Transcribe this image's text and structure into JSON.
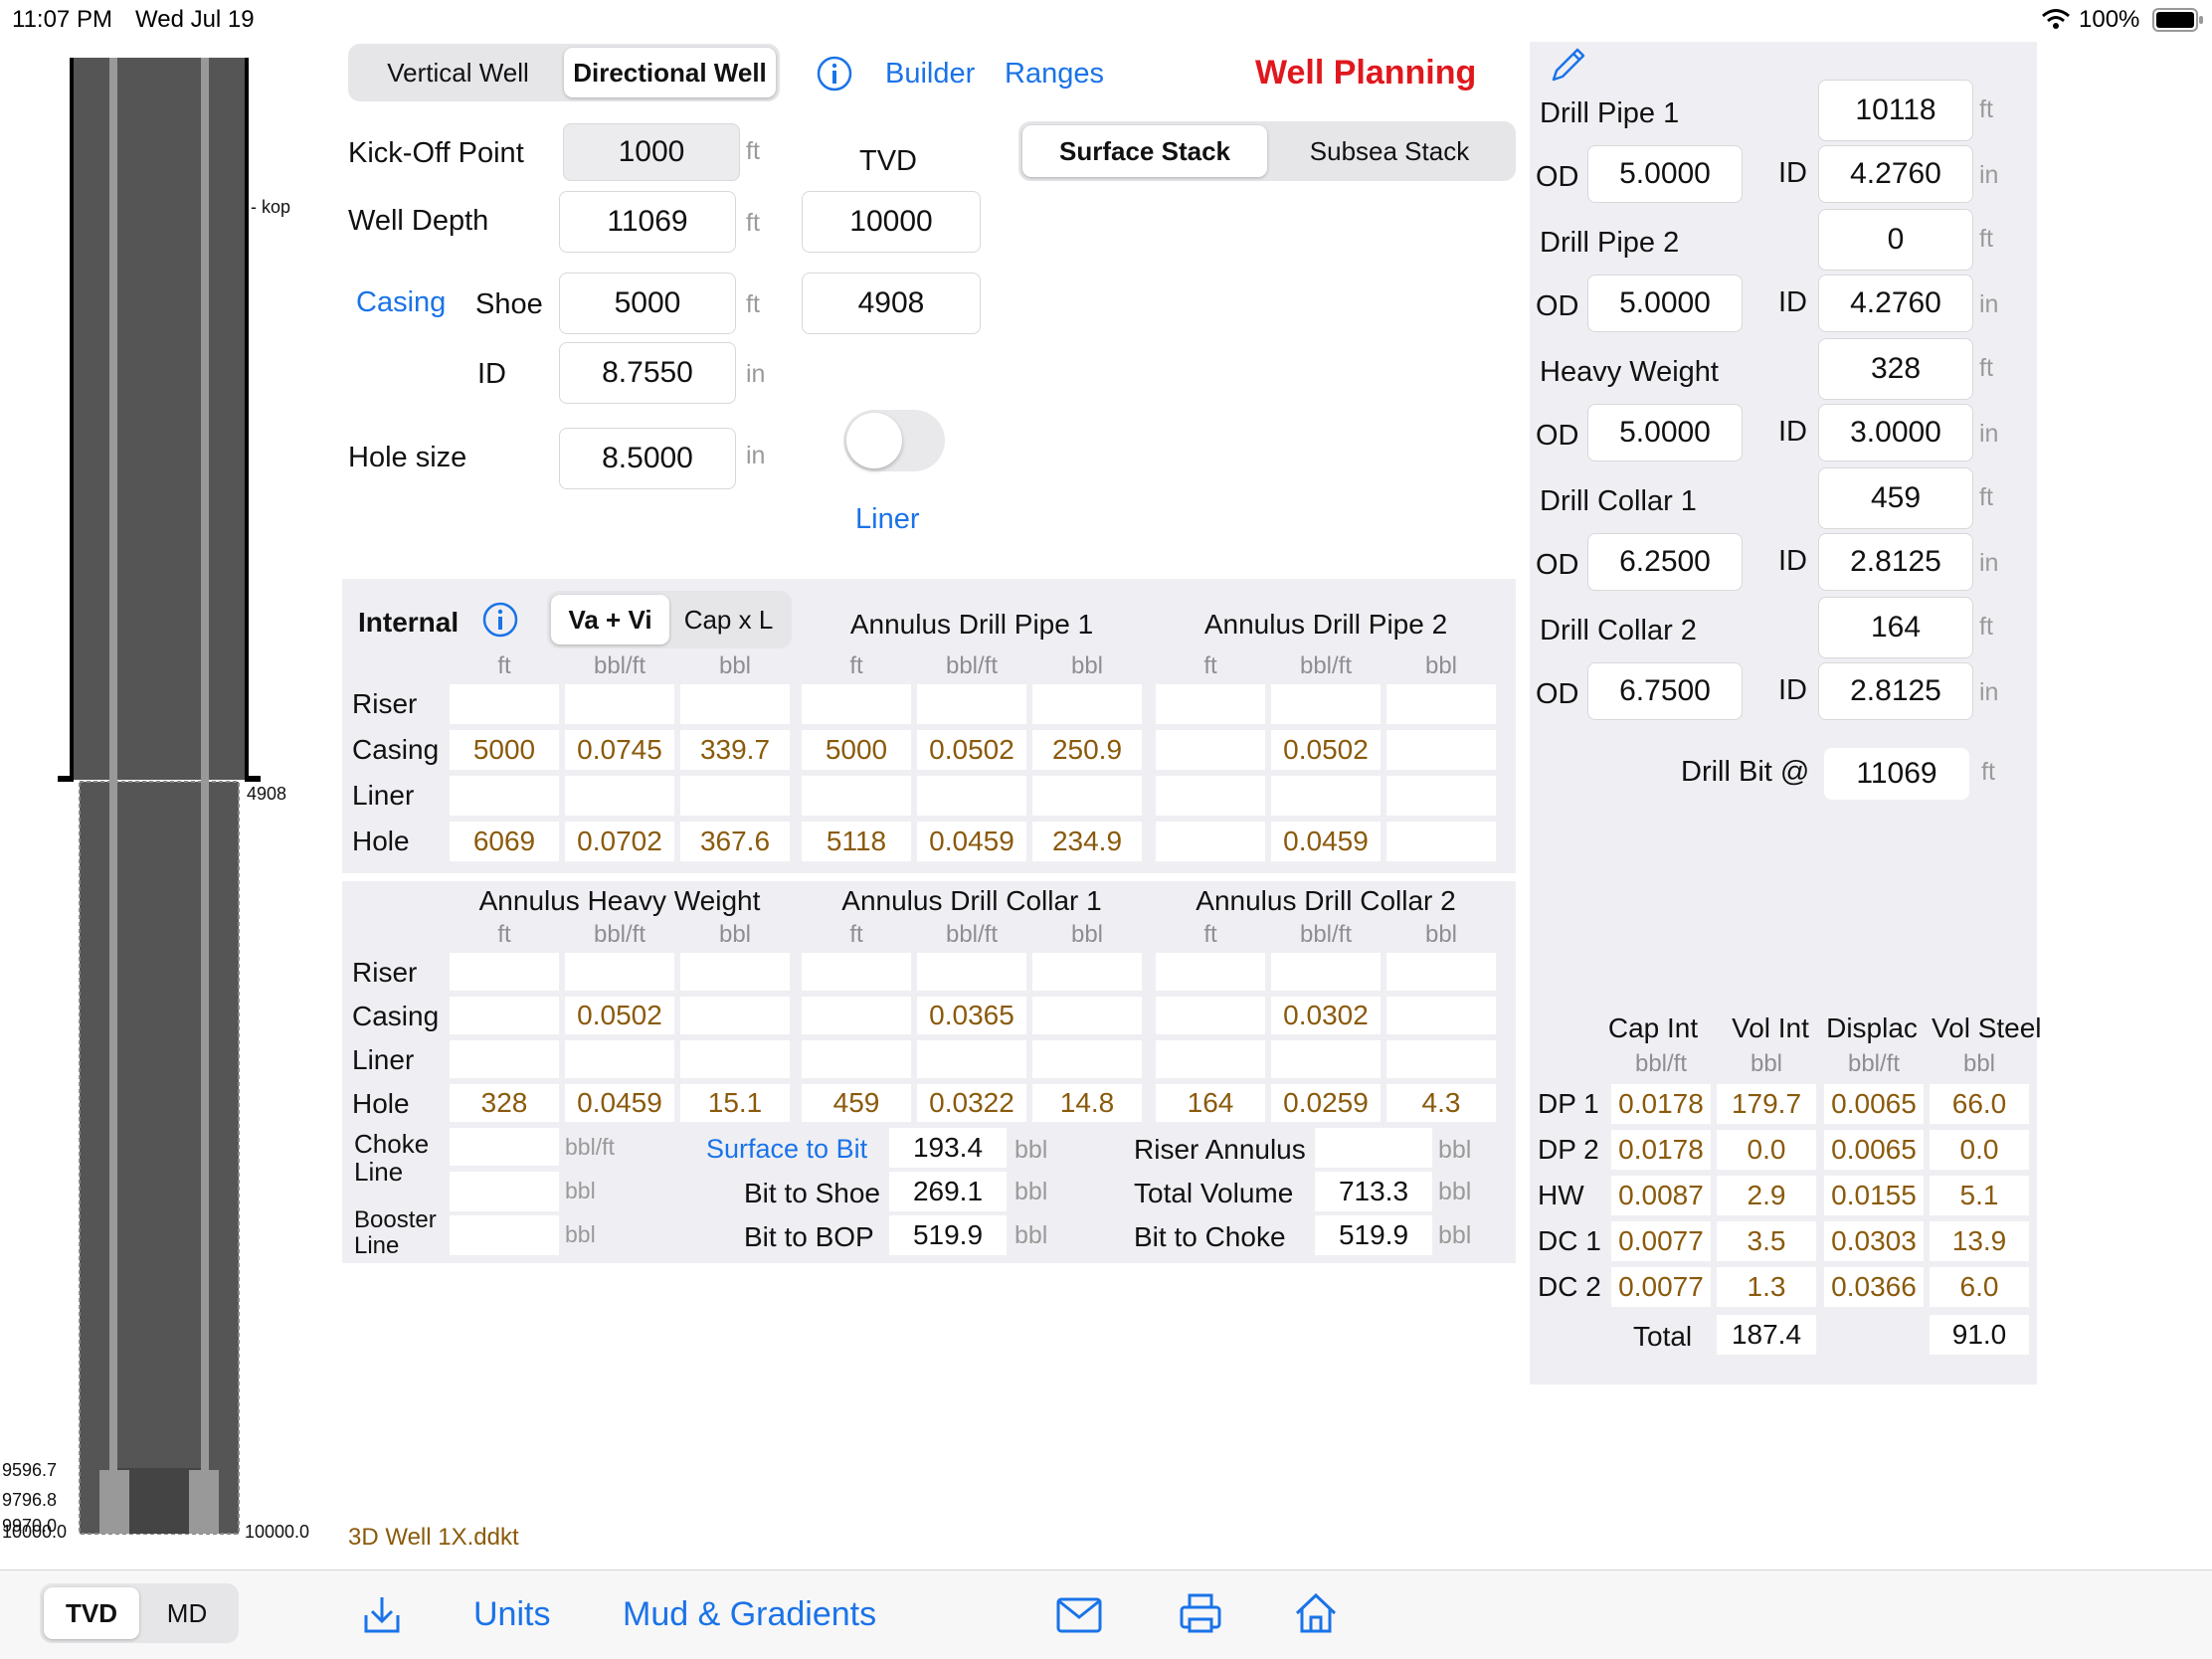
{
  "status": {
    "time": "11:07 PM",
    "date": "Wed Jul 19",
    "battery": "100%"
  },
  "well_tabs": {
    "options": [
      "Vertical Well",
      "Directional Well"
    ],
    "selected": "Directional Well"
  },
  "nav": {
    "info_icon": "info-icon",
    "builder": "Builder",
    "ranges": "Ranges"
  },
  "title": "Well Planning",
  "stack_tabs": {
    "options": [
      "Surface Stack",
      "Subsea Stack"
    ],
    "selected": "Surface Stack"
  },
  "well": {
    "kop_label": "Kick-Off Point",
    "kop_value": "1000",
    "kop_unit": "ft",
    "tvd_label": "TVD",
    "depth_label": "Well Depth",
    "depth_value": "11069",
    "depth_unit": "ft",
    "depth_tvd": "10000",
    "casing_link": "Casing",
    "shoe_label": "Shoe",
    "shoe_value": "5000",
    "shoe_unit": "ft",
    "shoe_tvd": "4908",
    "id_label": "ID",
    "id_value": "8.7550",
    "id_unit": "in",
    "hole_label": "Hole size",
    "hole_value": "8.5000",
    "hole_unit": "in",
    "liner_label": "Liner"
  },
  "drill_string": {
    "dp1": {
      "label": "Drill Pipe 1",
      "length": "10118",
      "od": "5.0000",
      "id": "4.2760"
    },
    "dp2": {
      "label": "Drill Pipe 2",
      "length": "0",
      "od": "5.0000",
      "id": "4.2760"
    },
    "hw": {
      "label": "Heavy Weight",
      "length": "328",
      "od": "5.0000",
      "id": "3.0000"
    },
    "dc1": {
      "label": "Drill Collar 1",
      "length": "459",
      "od": "6.2500",
      "id": "2.8125"
    },
    "dc2": {
      "label": "Drill Collar 2",
      "length": "164",
      "od": "6.7500",
      "id": "2.8125"
    },
    "od_label": "OD",
    "id_label": "ID",
    "ft": "ft",
    "in": "in",
    "bit_label": "Drill Bit @",
    "bit_value": "11069",
    "bit_unit": "ft"
  },
  "internal": {
    "title": "Internal",
    "toggle": {
      "options": [
        "Va + Vi",
        "Cap x L"
      ],
      "selected": "Va + Vi"
    },
    "sub_units": [
      "ft",
      "bbl/ft",
      "bbl"
    ],
    "rows": [
      "Riser",
      "Casing",
      "Liner",
      "Hole"
    ],
    "groups": [
      {
        "title": "",
        "cells": [
          [
            "",
            "",
            ""
          ],
          [
            "5000",
            "0.0745",
            "339.7"
          ],
          [
            "",
            "",
            ""
          ],
          [
            "6069",
            "0.0702",
            "367.6"
          ]
        ]
      },
      {
        "title": "Annulus Drill Pipe 1",
        "cells": [
          [
            "",
            "",
            ""
          ],
          [
            "5000",
            "0.0502",
            "250.9"
          ],
          [
            "",
            "",
            ""
          ],
          [
            "5118",
            "0.0459",
            "234.9"
          ]
        ]
      },
      {
        "title": "Annulus Drill Pipe 2",
        "cells": [
          [
            "",
            "",
            ""
          ],
          [
            "",
            "0.0502",
            ""
          ],
          [
            "",
            "",
            ""
          ],
          [
            "",
            "0.0459",
            ""
          ]
        ]
      }
    ]
  },
  "annulus2": {
    "sub_units": [
      "ft",
      "bbl/ft",
      "bbl"
    ],
    "rows": [
      "Riser",
      "Casing",
      "Liner",
      "Hole"
    ],
    "groups": [
      {
        "title": "Annulus Heavy Weight",
        "cells": [
          [
            "",
            "",
            ""
          ],
          [
            "",
            "0.0502",
            ""
          ],
          [
            "",
            "",
            ""
          ],
          [
            "328",
            "0.0459",
            "15.1"
          ]
        ]
      },
      {
        "title": "Annulus Drill Collar 1",
        "cells": [
          [
            "",
            "",
            ""
          ],
          [
            "",
            "0.0365",
            ""
          ],
          [
            "",
            "",
            ""
          ],
          [
            "459",
            "0.0322",
            "14.8"
          ]
        ]
      },
      {
        "title": "Annulus Drill Collar 2",
        "cells": [
          [
            "",
            "",
            ""
          ],
          [
            "",
            "0.0302",
            ""
          ],
          [
            "",
            "",
            ""
          ],
          [
            "164",
            "0.0259",
            "4.3"
          ]
        ]
      }
    ]
  },
  "lines": {
    "choke_label": "Choke Line",
    "booster_label": "Booster Line",
    "choke_unit1": "bbl/ft",
    "choke_unit2": "bbl",
    "booster_unit": "bbl"
  },
  "volumes": {
    "surface_to_bit_label": "Surface to Bit",
    "surface_to_bit": "193.4",
    "bit_to_shoe_label": "Bit to Shoe",
    "bit_to_shoe": "269.1",
    "bit_to_bop_label": "Bit to BOP",
    "bit_to_bop": "519.9",
    "riser_annulus_label": "Riser Annulus",
    "riser_annulus": "",
    "total_volume_label": "Total Volume",
    "total_volume": "713.3",
    "bit_to_choke_label": "Bit to Choke",
    "bit_to_choke": "519.9",
    "unit": "bbl"
  },
  "summary": {
    "headers": [
      "Cap Int",
      "Vol Int",
      "Displac",
      "Vol Steel"
    ],
    "units": [
      "bbl/ft",
      "bbl",
      "bbl/ft",
      "bbl"
    ],
    "rows": [
      {
        "label": "DP 1",
        "values": [
          "0.0178",
          "179.7",
          "0.0065",
          "66.0"
        ]
      },
      {
        "label": "DP 2",
        "values": [
          "0.0178",
          "0.0",
          "0.0065",
          "0.0"
        ]
      },
      {
        "label": "HW",
        "values": [
          "0.0087",
          "2.9",
          "0.0155",
          "5.1"
        ]
      },
      {
        "label": "DC 1",
        "values": [
          "0.0077",
          "3.5",
          "0.0303",
          "13.9"
        ]
      },
      {
        "label": "DC 2",
        "values": [
          "0.0077",
          "1.3",
          "0.0366",
          "6.0"
        ]
      }
    ],
    "total_label": "Total",
    "total_vol_int": "187.4",
    "total_vol_steel": "91.0"
  },
  "schematic": {
    "kop_label": "- kop",
    "shoe_label": "4908",
    "depth_9596": "9596.7",
    "depth_9796": "9796.8",
    "depth_9970": "9970.0",
    "depth_10000_left": "10000.0",
    "depth_10000_right": "10000.0"
  },
  "file_name": "3D Well 1X.ddkt",
  "tabbar": {
    "depth_toggle": {
      "options": [
        "TVD",
        "MD"
      ],
      "selected": "TVD"
    },
    "units": "Units",
    "mud": "Mud & Gradients"
  }
}
